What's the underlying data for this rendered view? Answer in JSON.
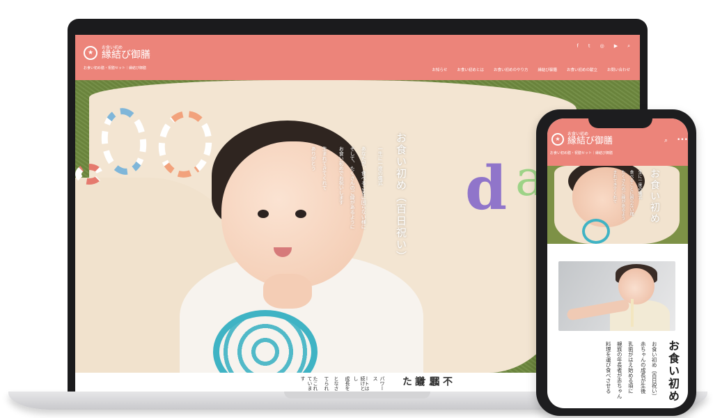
{
  "brand": {
    "logo_sub": "お食い初め",
    "logo_main": "縁結び御膳",
    "logo_mark": "★",
    "tagline": "お食い初め膳・祝膳セット｜縁結び御膳"
  },
  "laptop": {
    "social": [
      "f",
      "t",
      "◎",
      "▶",
      "⌕"
    ],
    "nav": [
      "お知らせ",
      "お食い初めとは",
      "お食い初めのやり方",
      "縁結び御膳",
      "お食い初めの献立",
      "お問い合わせ"
    ],
    "hero": {
      "title": "お食い初め（百日祝い）",
      "lines": [
        "一生に一度の儀式",
        "あなたが、食べることに困らない様に",
        "そして、たくさんのご縁があるように",
        "お食い初めでお祝いします",
        "生まれてきてくれて",
        "ありがとう"
      ]
    },
    "below": {
      "heading": "不思議",
      "heading2": "届けた",
      "lines": [
        "パワース",
        "ートは",
        "続けとし",
        "成長を",
        "となさ",
        "てられ",
        "たこれ",
        "ています"
      ]
    }
  },
  "phone": {
    "search_icon": "⌕",
    "more_icon": "•••",
    "hero": {
      "title": "お食い初め",
      "lines": [
        "生に一度の儀式",
        "食べることに困らない様",
        "たくさんのご縁があるよう",
        "まれてきてくれて"
      ]
    },
    "article": {
      "title": "お食い初め",
      "lines": [
        "お食い初め（百日祝い）",
        "赤ちゃんの成長が生後",
        "乳歯がはえ始める頃に",
        "親族の年長者が赤ちゃん",
        "料理を運び食べさせる",
        "赤ちゃん"
      ]
    }
  }
}
